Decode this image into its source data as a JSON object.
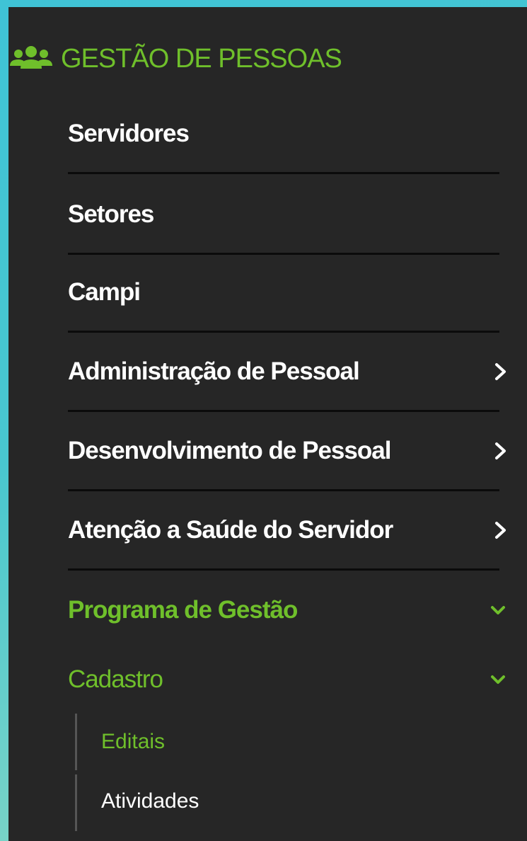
{
  "colors": {
    "accent": "#6fbf2b",
    "panel": "#262626",
    "text": "#ffffff",
    "divider": "#0b0b0b"
  },
  "header": {
    "icon": "users-icon",
    "title": "GESTÃO DE PESSOAS"
  },
  "menu": {
    "items": [
      {
        "label": "Servidores",
        "has_submenu": false
      },
      {
        "label": "Setores",
        "has_submenu": false
      },
      {
        "label": "Campi",
        "has_submenu": false
      },
      {
        "label": "Administração de Pessoal",
        "has_submenu": true,
        "icon": "chevron-right-icon"
      },
      {
        "label": "Desenvolvimento de Pessoal",
        "has_submenu": true,
        "icon": "chevron-right-icon"
      },
      {
        "label": "Atenção a Saúde do Servidor",
        "has_submenu": true,
        "icon": "chevron-right-icon"
      }
    ],
    "programa": {
      "label": "Programa de Gestão",
      "icon": "chevron-down-icon",
      "expanded": true,
      "cadastro": {
        "label": "Cadastro",
        "icon": "chevron-down-icon",
        "expanded": true,
        "children": [
          {
            "label": "Editais",
            "active": true
          },
          {
            "label": "Atividades",
            "active": false
          }
        ]
      }
    }
  }
}
